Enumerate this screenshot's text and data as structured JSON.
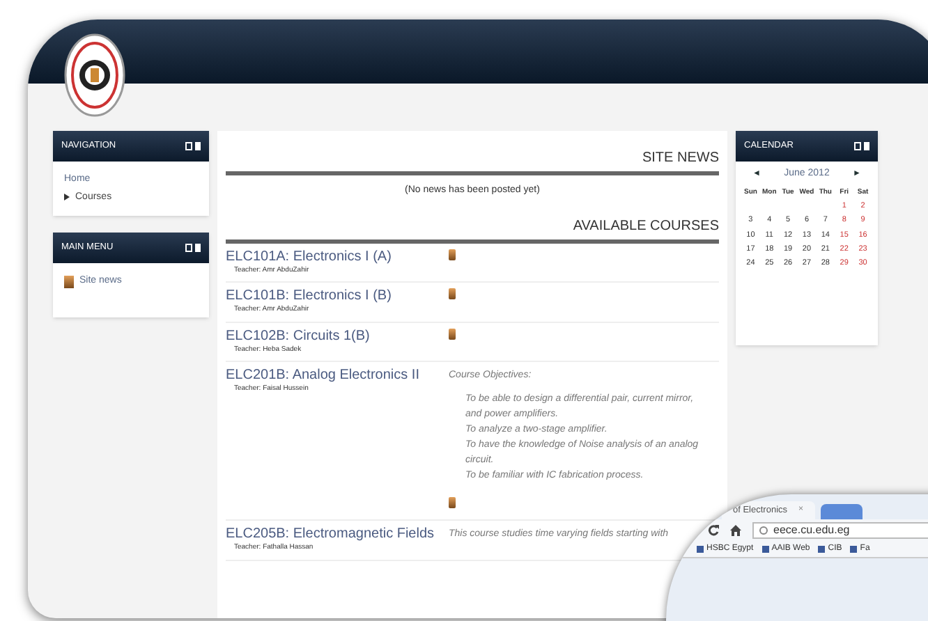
{
  "navigation": {
    "title": "NAVIGATION",
    "items": [
      {
        "label": "Home",
        "kind": "link"
      },
      {
        "label": "Courses",
        "kind": "branch",
        "expanded": false
      }
    ]
  },
  "main_menu": {
    "title": "MAIN MENU",
    "items": [
      {
        "label": "Site news"
      }
    ]
  },
  "site_news": {
    "title": "SITE NEWS",
    "message": "(No news has been posted yet)"
  },
  "available_courses": {
    "title": "AVAILABLE COURSES",
    "courses": [
      {
        "name": "ELC101A: Electronics I (A)",
        "teacher": "Teacher: Amr AbduZahir"
      },
      {
        "name": "ELC101B: Electronics I (B)",
        "teacher": "Teacher: Amr AbduZahir"
      },
      {
        "name": "ELC102B: Circuits 1(B)",
        "teacher": "Teacher: Heba Sadek"
      },
      {
        "name": "ELC201B: Analog Electronics II",
        "teacher": "Teacher: Faisal Hussein",
        "summary_title": "Course Objectives:",
        "objectives": [
          "To be able to design a differential pair, current mirror, and power amplifiers.",
          "To analyze a two-stage amplifier.",
          "To have the knowledge of Noise analysis of an analog circuit.",
          "To be familiar with IC fabrication process."
        ]
      },
      {
        "name": "ELC205B: Electromagnetic Fields",
        "teacher": "Teacher: Fathalla Hassan",
        "description": "This course studies time varying fields starting with"
      }
    ]
  },
  "calendar": {
    "title": "CALENDAR",
    "prev": "◄",
    "month": "June 2012",
    "next": "►",
    "weekdays": [
      "Sun",
      "Mon",
      "Tue",
      "Wed",
      "Thu",
      "Fri",
      "Sat"
    ],
    "weeks": [
      [
        {
          "day": "1",
          "weekend": true
        },
        {
          "day": "2",
          "weekend": true
        }
      ],
      [
        {
          "day": "3",
          "weekend": false
        },
        {
          "day": "4",
          "weekend": false
        },
        {
          "day": "5",
          "weekend": false
        },
        {
          "day": "6",
          "weekend": false
        },
        {
          "day": "7",
          "weekend": false
        },
        {
          "day": "8",
          "weekend": true
        },
        {
          "day": "9",
          "weekend": true
        }
      ],
      [
        {
          "day": "10",
          "weekend": false
        },
        {
          "day": "11",
          "weekend": false
        },
        {
          "day": "12",
          "weekend": false
        },
        {
          "day": "13",
          "weekend": false
        },
        {
          "day": "14",
          "weekend": false
        },
        {
          "day": "15",
          "weekend": true
        },
        {
          "day": "16",
          "weekend": true
        }
      ],
      [
        {
          "day": "17",
          "weekend": false
        },
        {
          "day": "18",
          "weekend": false
        },
        {
          "day": "19",
          "weekend": false
        },
        {
          "day": "20",
          "weekend": false
        },
        {
          "day": "21",
          "weekend": false
        },
        {
          "day": "22",
          "weekend": true
        },
        {
          "day": "23",
          "weekend": true
        }
      ],
      [
        {
          "day": "24",
          "weekend": false
        },
        {
          "day": "25",
          "weekend": false
        },
        {
          "day": "26",
          "weekend": false
        },
        {
          "day": "27",
          "weekend": false
        },
        {
          "day": "28",
          "weekend": false
        },
        {
          "day": "29",
          "weekend": true
        },
        {
          "day": "30",
          "weekend": true
        }
      ]
    ]
  },
  "browser": {
    "tab_title": "of Electronics",
    "tab_close": "×",
    "url": "eece.cu.edu.eg",
    "bookmarks": [
      "HSBC Egypt",
      "AAIB Web",
      "CIB",
      "Fa"
    ]
  }
}
